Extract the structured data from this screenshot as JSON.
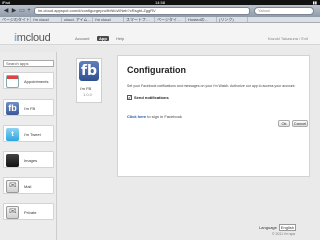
{
  "status_bar": {
    "carrier": "iPad",
    "time": "14:58",
    "battery": "▮▮"
  },
  "browser": {
    "back": "◀",
    "forward": "▶",
    "bookmarks_icon": "▭",
    "add_icon": "+",
    "url": "im-cloud.appspot.com/#/configurgepro/fbNtLWNeb?cRsgbLZggRV",
    "search_placeholder": "Yahoo!",
    "bookmarks": [
      "ページのタイト…",
      "i'm cloud",
      "cloud. アイム…",
      "i'm cloud",
      "スマートフ…",
      "ページタイ…",
      "Hostedの…",
      "(リンク)"
    ]
  },
  "header": {
    "logo_prefix": "i",
    "logo_text": "mcloud",
    "tabs": [
      {
        "label": "Account",
        "active": false
      },
      {
        "label": "App",
        "active": true
      },
      {
        "label": "Help",
        "active": false
      }
    ],
    "user": "Kazuki Takasuna / Exit"
  },
  "sidebar": {
    "search_placeholder": "Search apps",
    "apps": [
      {
        "label": "Appointments",
        "icon": "calendar-icon"
      },
      {
        "label": "i'm FB",
        "icon": "facebook-icon",
        "glyph": "fb"
      },
      {
        "label": "i'm Tweet",
        "icon": "twitter-icon",
        "glyph": "t"
      },
      {
        "label": "Images",
        "icon": "image-icon"
      },
      {
        "label": "Mail",
        "icon": "mail-icon"
      },
      {
        "label": "Private",
        "icon": "lock-icon"
      }
    ]
  },
  "app_card": {
    "glyph": "fb",
    "name": "i'm FB",
    "version": "1.0.0"
  },
  "config": {
    "title": "Configuration",
    "description": "Set your Facebook notifications and messages on your i'm Watch. Authorize our app to access your account.",
    "checkbox_label": "Send notifications",
    "checkbox_mark": "✓",
    "link_text": "Click here",
    "link_suffix": " to sign in Facebook",
    "ok_label": "Ok",
    "cancel_label": "Cancel"
  },
  "footer": {
    "language_label": "Language",
    "language_value": "English",
    "copyright": "© 2011 i'm spa"
  }
}
